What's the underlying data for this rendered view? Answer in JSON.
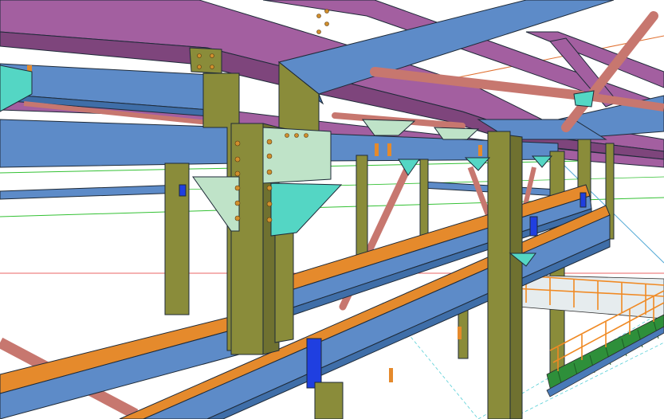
{
  "viewport": {
    "type": "3d-steel-structure-model",
    "background": "#ffffff"
  },
  "colors": {
    "column": "#8a8c3a",
    "column_dark": "#6f7130",
    "beam_blue": "#5d8bc8",
    "beam_blue_dark": "#3f6ea8",
    "rafter_purple": "#a35fa0",
    "rafter_purple_dark": "#7e457c",
    "brace_pink": "#c7776f",
    "plate_cyan": "#54d6c4",
    "flange_orange": "#e58a2c",
    "stiffener_blue": "#1f3fe0",
    "stair_green": "#2e8f3a",
    "handrail_orange": "#f08a24",
    "grid_green": "#33c133",
    "grid_red": "#e03030",
    "grid_cyan": "#55cfd6"
  },
  "layers": [
    {
      "name": "roof-rafters",
      "color_key": "rafter_purple"
    },
    {
      "name": "columns",
      "color_key": "column"
    },
    {
      "name": "crane-beams",
      "color_key": "beam_blue"
    },
    {
      "name": "bracing",
      "color_key": "brace_pink"
    },
    {
      "name": "connection-plates",
      "color_key": "plate_cyan"
    },
    {
      "name": "platform-stairs",
      "color_key": "stair_green"
    },
    {
      "name": "grid-lines",
      "color_key": "grid_green"
    }
  ]
}
